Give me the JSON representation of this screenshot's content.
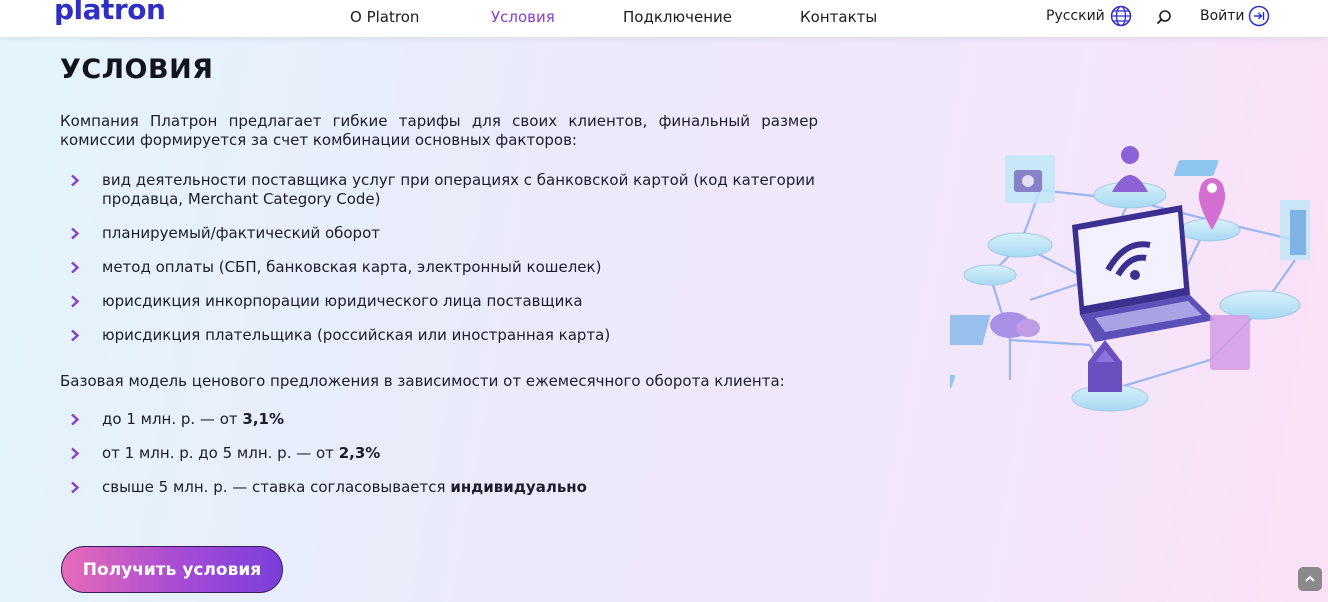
{
  "header": {
    "logo": "platron",
    "nav": [
      "О Platron",
      "Условия",
      "Подключение",
      "Контакты"
    ],
    "active_nav": "Условия",
    "language": "Русский",
    "login": "Войти"
  },
  "main": {
    "title": "УСЛОВИЯ",
    "intro": "Компания Платрон предлагает гибкие тарифы для своих клиентов, финальный размер комиссии формируется за счет комбинации основных факторов:",
    "factors": [
      "вид деятельности поставщика услуг при операциях с банковской картой (код категории продавца, Merchant Category Code)",
      "планируемый/фактический оборот",
      "метод оплаты (СБП, банковская карта, электронный кошелек)",
      "юрисдикция инкорпорации юридического лица поставщика",
      "юрисдикция плательщика (российская или иностранная карта)"
    ],
    "base_model": "Базовая модель ценового предложения в зависимости от ежемесячного оборота клиента:",
    "tariffs": [
      {
        "text": "до 1 млн. р. — от ",
        "bold": "3,1%"
      },
      {
        "text": "от 1 млн. р. до 5 млн. р. — от ",
        "bold": "2,3%"
      },
      {
        "text": "свыше 5 млн. р. — ставка согласовывается ",
        "bold": "индивидуально"
      }
    ],
    "cta": "Получить условия"
  },
  "colors": {
    "brand": "#2f2fc4",
    "accent": "#8a3fc7",
    "chevron": "#8a3fc7"
  }
}
